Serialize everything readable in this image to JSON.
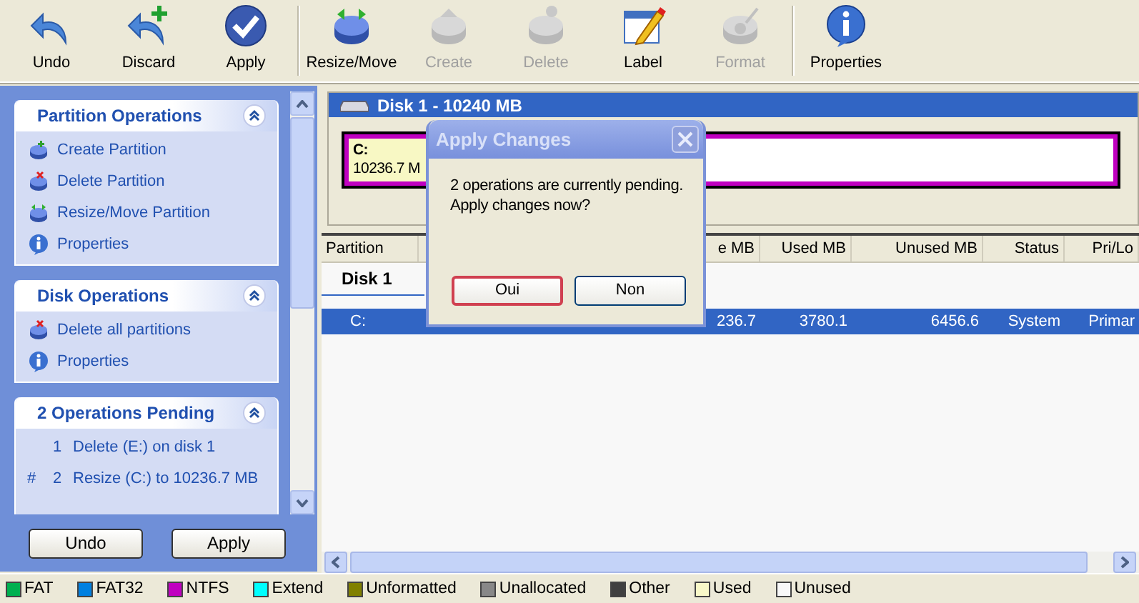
{
  "toolbar": {
    "groups": [
      [
        {
          "label": "Undo",
          "disabled": false
        },
        {
          "label": "Discard",
          "disabled": false
        },
        {
          "label": "Apply",
          "disabled": false
        }
      ],
      [
        {
          "label": "Resize/Move",
          "disabled": false
        },
        {
          "label": "Create",
          "disabled": true
        },
        {
          "label": "Delete",
          "disabled": true
        },
        {
          "label": "Label",
          "disabled": false
        },
        {
          "label": "Format",
          "disabled": true
        }
      ],
      [
        {
          "label": "Properties",
          "disabled": false
        }
      ]
    ]
  },
  "sidebar": {
    "panels": [
      {
        "title": "Partition Operations",
        "kind": "actions",
        "items": [
          {
            "text": "Create Partition"
          },
          {
            "text": "Delete Partition"
          },
          {
            "text": "Resize/Move Partition"
          },
          {
            "text": "Properties"
          }
        ]
      },
      {
        "title": "Disk Operations",
        "kind": "actions",
        "items": [
          {
            "text": "Delete all partitions"
          },
          {
            "text": "Properties"
          }
        ]
      },
      {
        "title": "2 Operations Pending",
        "kind": "pending",
        "items": [
          {
            "number": "1",
            "text": "Delete (E:) on disk 1"
          },
          {
            "marker": "#",
            "number": "2",
            "text": "Resize (C:) to 10236.7 MB"
          }
        ]
      }
    ],
    "buttons": [
      "Undo",
      "Apply"
    ]
  },
  "disk": {
    "title": "Disk 1 - 10240 MB",
    "partition": {
      "label": "C:",
      "size": "10236.7 M",
      "level": 0.37,
      "color": "#c000c0"
    }
  },
  "table": {
    "columns": [
      "Partition",
      "e MB",
      "Used MB",
      "Unused MB",
      "Status",
      "Pri/Lo"
    ],
    "rows": [
      {
        "kind": "disk",
        "cells": [
          "Disk 1"
        ],
        "selected": false
      },
      {
        "kind": "partition",
        "cells": [
          "C:",
          "236.7",
          "3780.1",
          "6456.6",
          "System",
          "Primar"
        ],
        "selected": true
      }
    ]
  },
  "dialog": {
    "title": "Apply Changes",
    "message": "2 operations are currently pending.\nApply changes now?",
    "buttons": [
      {
        "label": "Oui",
        "focused": true
      },
      {
        "label": "Non",
        "focused": false
      }
    ]
  },
  "legend": [
    {
      "label": "FAT",
      "color": "#00b050"
    },
    {
      "label": "FAT32",
      "color": "#0080e0"
    },
    {
      "label": "NTFS",
      "color": "#c000c0"
    },
    {
      "label": "Extend",
      "color": "#00ffff"
    },
    {
      "label": "Unformatted",
      "color": "#808000"
    },
    {
      "label": "Unallocated",
      "color": "#888888"
    },
    {
      "label": "Other",
      "color": "#404040"
    },
    {
      "label": "Used",
      "color": "#f8f8c8"
    },
    {
      "label": "Unused",
      "color": "#f8f8f8"
    }
  ]
}
